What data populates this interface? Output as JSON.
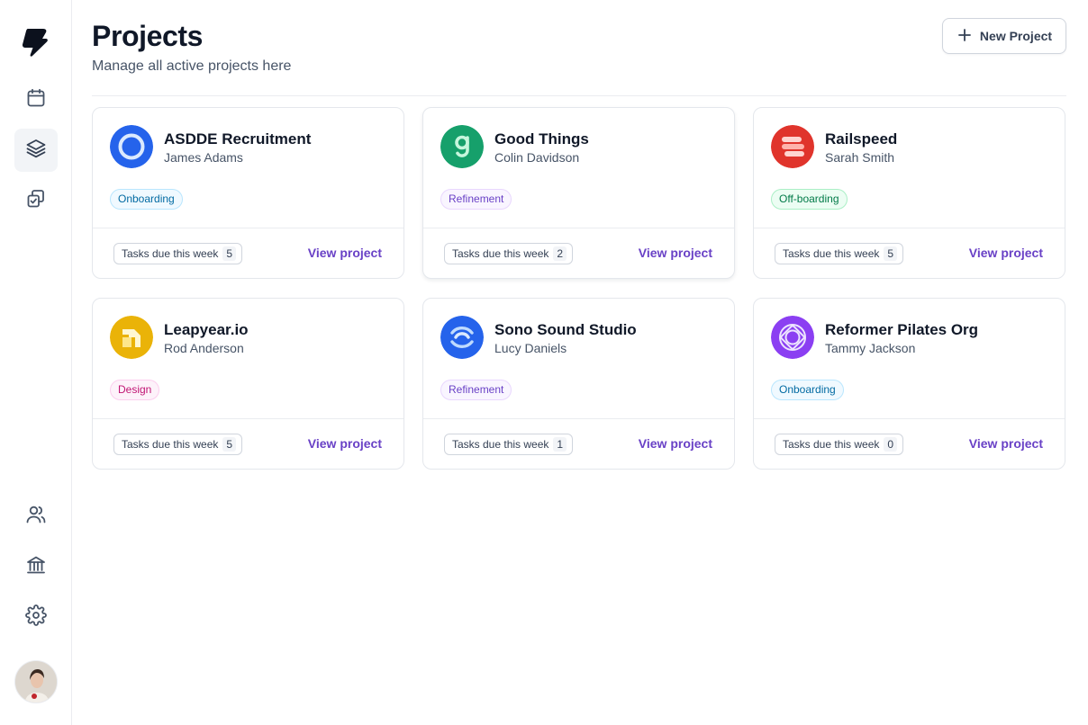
{
  "sidebar": {
    "logo_icon": "lightning-bolt-logo",
    "top_items": [
      {
        "icon": "calendar-icon",
        "active": false
      },
      {
        "icon": "layers-icon",
        "active": true
      },
      {
        "icon": "check-copy-icon",
        "active": false
      }
    ],
    "bottom_items": [
      {
        "icon": "users-icon"
      },
      {
        "icon": "bank-icon"
      },
      {
        "icon": "settings-icon"
      }
    ]
  },
  "header": {
    "title": "Projects",
    "subtitle": "Manage all active projects here",
    "new_button_label": "New Project"
  },
  "projects": [
    {
      "name": "ASDDE Recruitment",
      "owner": "James Adams",
      "status": "Onboarding",
      "status_color": "#026aa2",
      "status_bg": "#f0f9ff",
      "status_border": "#b9e6fe",
      "tasks_label": "Tasks due this week",
      "tasks_count": "5",
      "link": "View project",
      "logo_icon": "ring-icon",
      "logo_color": "#2563eb"
    },
    {
      "name": "Good Things",
      "owner": "Colin Davidson",
      "status": "Refinement",
      "status_color": "#6941c6",
      "status_bg": "#f9f5ff",
      "status_border": "#e9d7fe",
      "tasks_label": "Tasks due this week",
      "tasks_count": "2",
      "link": "View project",
      "logo_icon": "letter-g-icon",
      "logo_color": "#16a06b"
    },
    {
      "name": "Railspeed",
      "owner": "Sarah Smith",
      "status": "Off-boarding",
      "status_color": "#027a48",
      "status_bg": "#ecfdf3",
      "status_border": "#abefc6",
      "tasks_label": "Tasks due this week",
      "tasks_count": "5",
      "link": "View project",
      "logo_icon": "stripes-icon",
      "logo_color": "#e0342c"
    },
    {
      "name": "Leapyear.io",
      "owner": "Rod Anderson",
      "status": "Design",
      "status_color": "#c11574",
      "status_bg": "#fdf2fa",
      "status_border": "#fcceee",
      "tasks_label": "Tasks due this week",
      "tasks_count": "5",
      "link": "View project",
      "logo_icon": "step-arrow-icon",
      "logo_color": "#eab308"
    },
    {
      "name": "Sono Sound Studio",
      "owner": "Lucy Daniels",
      "status": "Refinement",
      "status_color": "#6941c6",
      "status_bg": "#f9f5ff",
      "status_border": "#e9d7fe",
      "tasks_label": "Tasks due this week",
      "tasks_count": "1",
      "link": "View project",
      "logo_icon": "sound-wave-icon",
      "logo_color": "#2563eb"
    },
    {
      "name": "Reformer Pilates Org",
      "owner": "Tammy Jackson",
      "status": "Onboarding",
      "status_color": "#026aa2",
      "status_bg": "#f0f9ff",
      "status_border": "#b9e6fe",
      "tasks_label": "Tasks due this week",
      "tasks_count": "0",
      "link": "View project",
      "logo_icon": "geometric-circle-icon",
      "logo_color": "#8b3ff2"
    }
  ],
  "colors": {
    "accent": "#6941c6",
    "border": "#e4e7ec",
    "text_primary": "#101828",
    "text_secondary": "#475467"
  }
}
